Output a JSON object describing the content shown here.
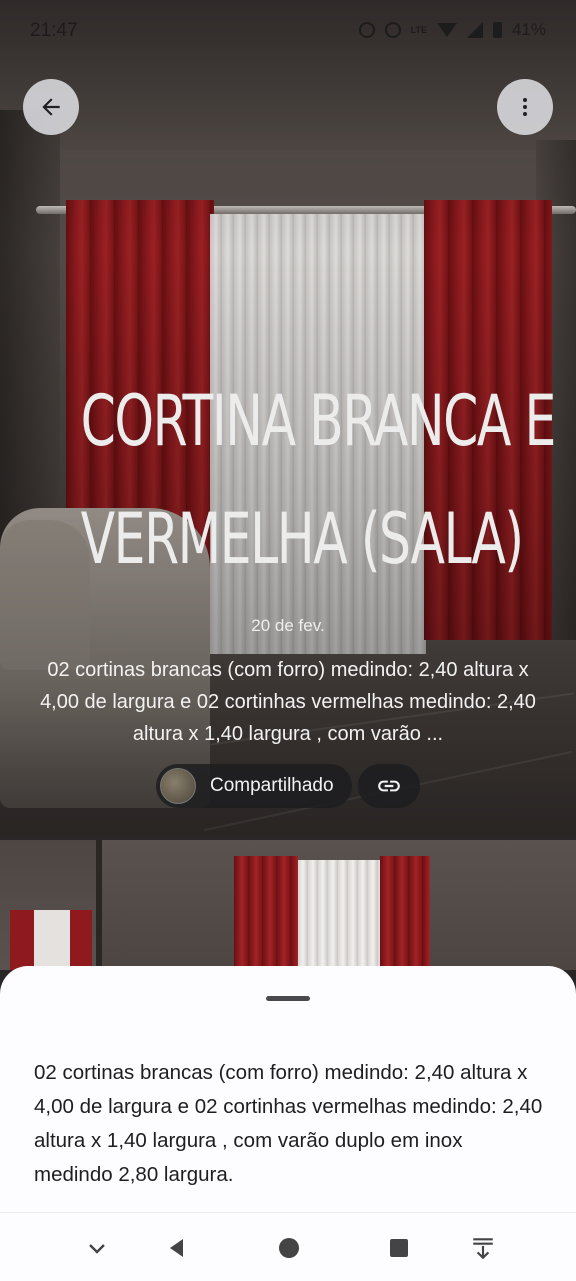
{
  "status_bar": {
    "time": "21:47",
    "battery": "41%",
    "network_label": "LTE",
    "icons": [
      "alarm-icon",
      "do-not-disturb-icon",
      "volte-icon",
      "wifi-icon",
      "signal-icon",
      "battery-icon"
    ]
  },
  "top_actions": {
    "back_icon": "arrow-left-icon",
    "more_icon": "more-vert-icon"
  },
  "memory": {
    "title_line1": "CORTINA BRANCA E",
    "title_line2": "VERMELHA (SALA)",
    "date": "20 de fev.",
    "description_preview": "02 cortinas brancas (com forro)  medindo: 2,40 altura x 4,00 de largura e 02 cortinhas vermelhas medindo: 2,40 altura x 1,40 largura , com varão ...",
    "shared_label": "Compartilhado",
    "link_icon": "link-icon"
  },
  "sheet": {
    "description_full": "02 cortinas brancas (com forro)  medindo: 2,40 altura x 4,00 de largura e 02 cortinhas vermelhas medindo: 2,40 altura x 1,40 largura , com varão duplo em inox medindo 2,80 largura."
  },
  "nav_bar": {
    "icons": [
      "chevron-down-icon",
      "back-triangle-icon",
      "home-circle-icon",
      "recents-square-icon",
      "scroll-down-icon"
    ]
  },
  "colors": {
    "curtain_red": "#8e1a1e",
    "sheet_bg": "#fdfdff",
    "chip_bg": "#1c1c1e"
  }
}
